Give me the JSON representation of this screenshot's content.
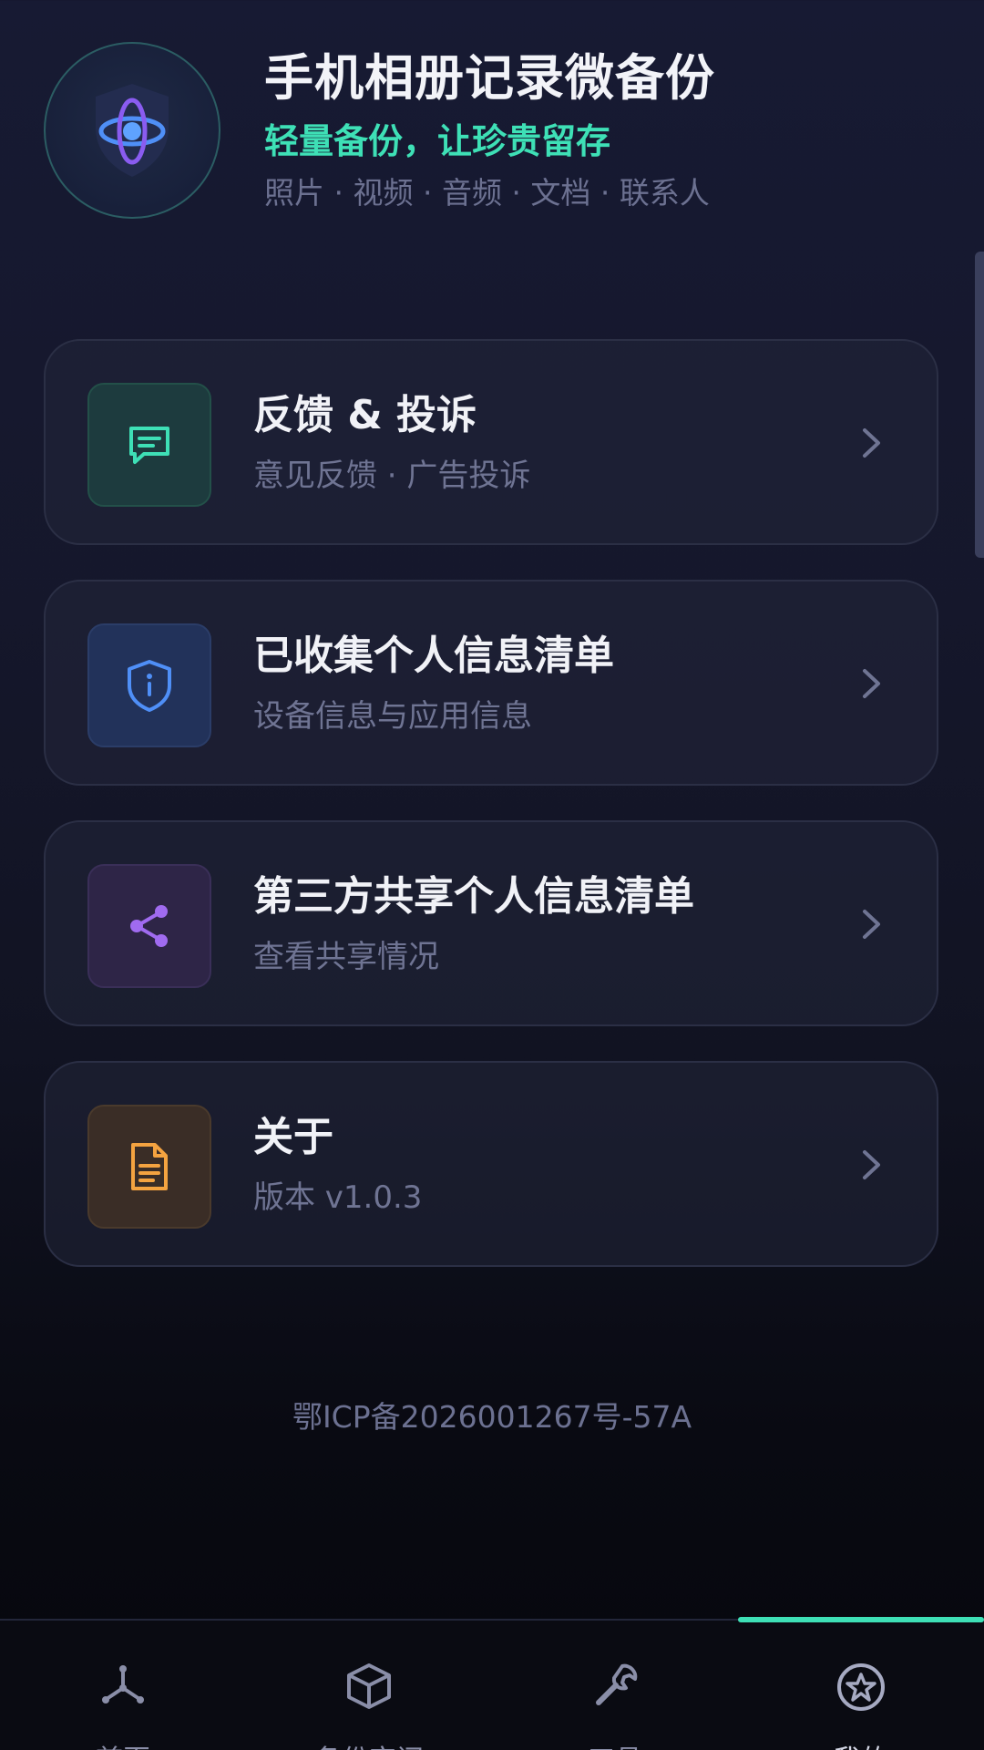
{
  "header": {
    "title": "手机相册记录微备份",
    "slogan": "轻量备份，让珍贵留存",
    "types": "照片 · 视频 · 音频 · 文档 · 联系人"
  },
  "menu": [
    {
      "title": "反馈 & 投诉",
      "subtitle": "意见反馈 · 广告投诉",
      "icon": "message-icon",
      "color": "#3ee0b6"
    },
    {
      "title": "已收集个人信息清单",
      "subtitle": "设备信息与应用信息",
      "icon": "shield-info-icon",
      "color": "#4f8ff7"
    },
    {
      "title": "第三方共享个人信息清单",
      "subtitle": "查看共享情况",
      "icon": "share-icon",
      "color": "#a06bf0"
    },
    {
      "title": "关于",
      "subtitle": "版本 v1.0.3",
      "icon": "document-icon",
      "color": "#f4a340"
    }
  ],
  "footer": {
    "icp": "鄂ICP备2026001267号-57A"
  },
  "bottom_nav": {
    "active_index": 3,
    "accent": "#3ee0b6",
    "items": [
      {
        "icon": "network-icon",
        "label": "首页"
      },
      {
        "icon": "box-icon",
        "label": "备份空间"
      },
      {
        "icon": "wrench-icon",
        "label": "工具"
      },
      {
        "icon": "star-icon",
        "label": "我的"
      }
    ]
  }
}
